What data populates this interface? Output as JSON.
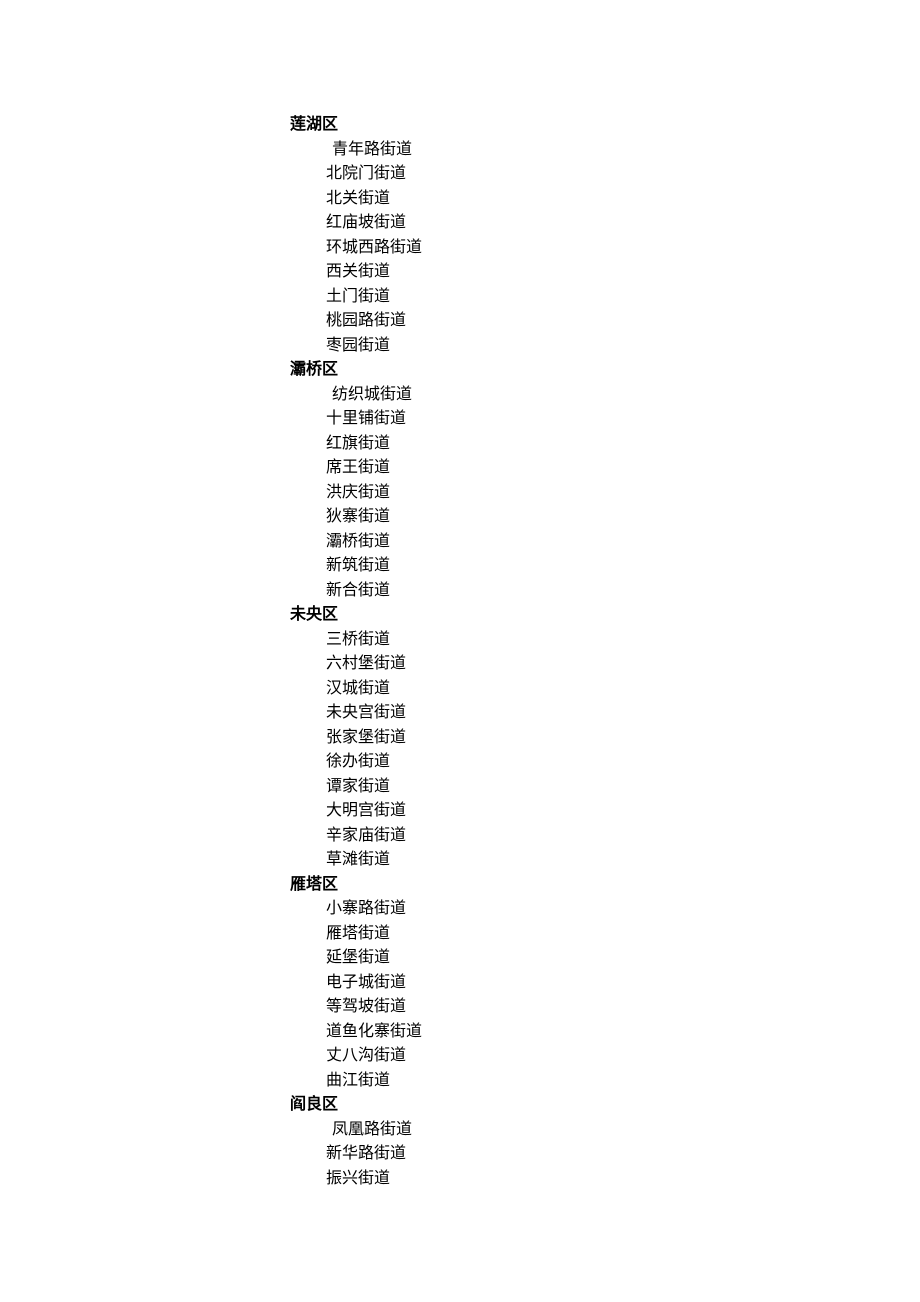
{
  "districts": [
    {
      "name": "莲湖区",
      "subdistricts": [
        "青年路街道",
        "北院门街道",
        "北关街道",
        "红庙坡街道",
        "环城西路街道",
        "西关街道",
        "土门街道",
        "桃园路街道",
        "枣园街道"
      ]
    },
    {
      "name": "灞桥区",
      "subdistricts": [
        "纺织城街道",
        "十里铺街道",
        "红旗街道",
        "席王街道",
        "洪庆街道",
        "狄寨街道",
        "灞桥街道",
        "新筑街道",
        "新合街道"
      ]
    },
    {
      "name": "未央区",
      "subdistricts": [
        "三桥街道",
        "六村堡街道",
        "汉城街道",
        "未央宫街道",
        "张家堡街道",
        "徐办街道",
        "谭家街道",
        "大明宫街道",
        "辛家庙街道",
        "草滩街道"
      ]
    },
    {
      "name": "雁塔区",
      "subdistricts": [
        "小寨路街道",
        "雁塔街道",
        "延堡街道",
        "电子城街道",
        "等驾坡街道",
        "道鱼化寨街道",
        "丈八沟街道",
        "曲江街道"
      ]
    },
    {
      "name": "阎良区",
      "subdistricts": [
        "凤凰路街道",
        "新华路街道",
        "振兴街道"
      ]
    }
  ]
}
